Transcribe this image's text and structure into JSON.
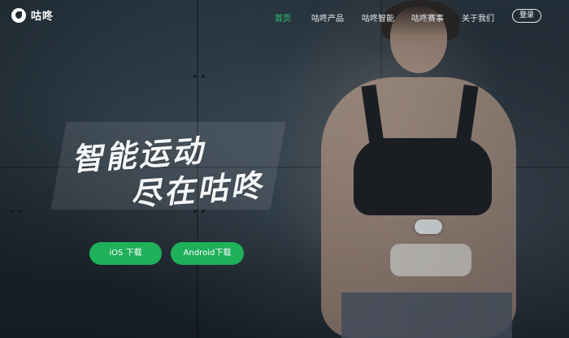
{
  "brand": {
    "name": "咕咚"
  },
  "nav": {
    "items": [
      {
        "label": "首页",
        "active": true
      },
      {
        "label": "咕咚产品",
        "active": false
      },
      {
        "label": "咕咚智能",
        "active": false
      },
      {
        "label": "咕咚赛事",
        "active": false
      },
      {
        "label": "关于我们",
        "active": false
      }
    ],
    "login_label": "登录"
  },
  "hero": {
    "slogan_line1": "智能运动",
    "slogan_line2": "尽在咕咚"
  },
  "downloads": {
    "ios_label": "iOS 下载",
    "android_label": "Android下载"
  },
  "colors": {
    "accent": "#1fb05a",
    "active_nav": "#2bc56a"
  }
}
